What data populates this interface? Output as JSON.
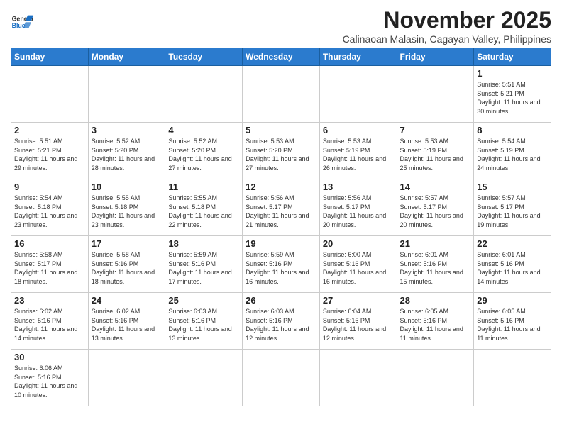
{
  "header": {
    "logo_general": "General",
    "logo_blue": "Blue",
    "title": "November 2025",
    "subtitle": "Calinaoan Malasin, Cagayan Valley, Philippines"
  },
  "weekdays": [
    "Sunday",
    "Monday",
    "Tuesday",
    "Wednesday",
    "Thursday",
    "Friday",
    "Saturday"
  ],
  "weeks": [
    [
      {
        "day": "",
        "info": ""
      },
      {
        "day": "",
        "info": ""
      },
      {
        "day": "",
        "info": ""
      },
      {
        "day": "",
        "info": ""
      },
      {
        "day": "",
        "info": ""
      },
      {
        "day": "",
        "info": ""
      },
      {
        "day": "1",
        "info": "Sunrise: 5:51 AM\nSunset: 5:21 PM\nDaylight: 11 hours and 30 minutes."
      }
    ],
    [
      {
        "day": "2",
        "info": "Sunrise: 5:51 AM\nSunset: 5:21 PM\nDaylight: 11 hours and 29 minutes."
      },
      {
        "day": "3",
        "info": "Sunrise: 5:52 AM\nSunset: 5:20 PM\nDaylight: 11 hours and 28 minutes."
      },
      {
        "day": "4",
        "info": "Sunrise: 5:52 AM\nSunset: 5:20 PM\nDaylight: 11 hours and 27 minutes."
      },
      {
        "day": "5",
        "info": "Sunrise: 5:53 AM\nSunset: 5:20 PM\nDaylight: 11 hours and 27 minutes."
      },
      {
        "day": "6",
        "info": "Sunrise: 5:53 AM\nSunset: 5:19 PM\nDaylight: 11 hours and 26 minutes."
      },
      {
        "day": "7",
        "info": "Sunrise: 5:53 AM\nSunset: 5:19 PM\nDaylight: 11 hours and 25 minutes."
      },
      {
        "day": "8",
        "info": "Sunrise: 5:54 AM\nSunset: 5:19 PM\nDaylight: 11 hours and 24 minutes."
      }
    ],
    [
      {
        "day": "9",
        "info": "Sunrise: 5:54 AM\nSunset: 5:18 PM\nDaylight: 11 hours and 23 minutes."
      },
      {
        "day": "10",
        "info": "Sunrise: 5:55 AM\nSunset: 5:18 PM\nDaylight: 11 hours and 23 minutes."
      },
      {
        "day": "11",
        "info": "Sunrise: 5:55 AM\nSunset: 5:18 PM\nDaylight: 11 hours and 22 minutes."
      },
      {
        "day": "12",
        "info": "Sunrise: 5:56 AM\nSunset: 5:17 PM\nDaylight: 11 hours and 21 minutes."
      },
      {
        "day": "13",
        "info": "Sunrise: 5:56 AM\nSunset: 5:17 PM\nDaylight: 11 hours and 20 minutes."
      },
      {
        "day": "14",
        "info": "Sunrise: 5:57 AM\nSunset: 5:17 PM\nDaylight: 11 hours and 20 minutes."
      },
      {
        "day": "15",
        "info": "Sunrise: 5:57 AM\nSunset: 5:17 PM\nDaylight: 11 hours and 19 minutes."
      }
    ],
    [
      {
        "day": "16",
        "info": "Sunrise: 5:58 AM\nSunset: 5:17 PM\nDaylight: 11 hours and 18 minutes."
      },
      {
        "day": "17",
        "info": "Sunrise: 5:58 AM\nSunset: 5:16 PM\nDaylight: 11 hours and 18 minutes."
      },
      {
        "day": "18",
        "info": "Sunrise: 5:59 AM\nSunset: 5:16 PM\nDaylight: 11 hours and 17 minutes."
      },
      {
        "day": "19",
        "info": "Sunrise: 5:59 AM\nSunset: 5:16 PM\nDaylight: 11 hours and 16 minutes."
      },
      {
        "day": "20",
        "info": "Sunrise: 6:00 AM\nSunset: 5:16 PM\nDaylight: 11 hours and 16 minutes."
      },
      {
        "day": "21",
        "info": "Sunrise: 6:01 AM\nSunset: 5:16 PM\nDaylight: 11 hours and 15 minutes."
      },
      {
        "day": "22",
        "info": "Sunrise: 6:01 AM\nSunset: 5:16 PM\nDaylight: 11 hours and 14 minutes."
      }
    ],
    [
      {
        "day": "23",
        "info": "Sunrise: 6:02 AM\nSunset: 5:16 PM\nDaylight: 11 hours and 14 minutes."
      },
      {
        "day": "24",
        "info": "Sunrise: 6:02 AM\nSunset: 5:16 PM\nDaylight: 11 hours and 13 minutes."
      },
      {
        "day": "25",
        "info": "Sunrise: 6:03 AM\nSunset: 5:16 PM\nDaylight: 11 hours and 13 minutes."
      },
      {
        "day": "26",
        "info": "Sunrise: 6:03 AM\nSunset: 5:16 PM\nDaylight: 11 hours and 12 minutes."
      },
      {
        "day": "27",
        "info": "Sunrise: 6:04 AM\nSunset: 5:16 PM\nDaylight: 11 hours and 12 minutes."
      },
      {
        "day": "28",
        "info": "Sunrise: 6:05 AM\nSunset: 5:16 PM\nDaylight: 11 hours and 11 minutes."
      },
      {
        "day": "29",
        "info": "Sunrise: 6:05 AM\nSunset: 5:16 PM\nDaylight: 11 hours and 11 minutes."
      }
    ],
    [
      {
        "day": "30",
        "info": "Sunrise: 6:06 AM\nSunset: 5:16 PM\nDaylight: 11 hours and 10 minutes."
      },
      {
        "day": "",
        "info": ""
      },
      {
        "day": "",
        "info": ""
      },
      {
        "day": "",
        "info": ""
      },
      {
        "day": "",
        "info": ""
      },
      {
        "day": "",
        "info": ""
      },
      {
        "day": "",
        "info": ""
      }
    ]
  ]
}
